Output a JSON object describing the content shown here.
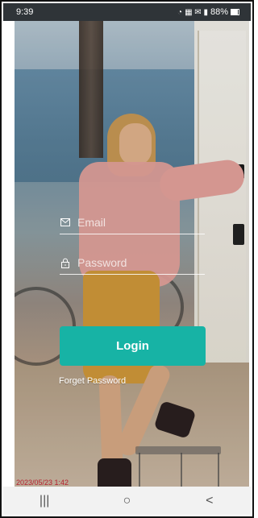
{
  "status_bar": {
    "time": "9:39",
    "indicators": "📶 ☱ ✉",
    "battery_text": "88%"
  },
  "login_form": {
    "email_placeholder": "Email",
    "password_placeholder": "Password",
    "login_label": "Login",
    "forgot_password": "Forget Password"
  },
  "overlay_text": {
    "timestamp": "2023/05/23 1:42"
  },
  "navigation": {
    "recent_apps_label": "|||",
    "home_label": "○",
    "back_label": "<"
  },
  "colors": {
    "login_button": "#17b3a5",
    "status_bar": "#2f3438",
    "timestamp": "#b51f2e"
  },
  "icons": {
    "email": "mail-icon",
    "password": "lock-icon"
  }
}
